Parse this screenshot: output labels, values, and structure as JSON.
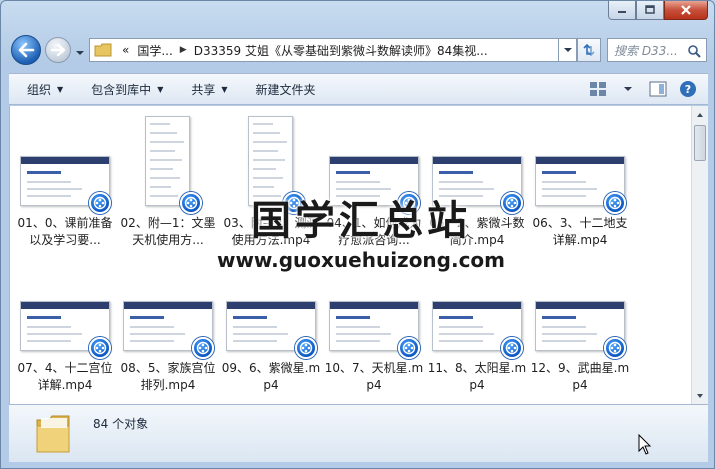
{
  "window": {
    "caption_buttons": [
      "minimize",
      "maximize",
      "close"
    ]
  },
  "address_bar": {
    "overflow": "«",
    "crumbs": [
      "国学...",
      "D33359 艾姐《从零基础到紫微斗数解读师》84集视..."
    ],
    "search_placeholder": "搜索 D33..."
  },
  "toolbar": {
    "items": [
      {
        "label": "组织",
        "has_arrow": true
      },
      {
        "label": "包含到库中",
        "has_arrow": true
      },
      {
        "label": "共享",
        "has_arrow": true
      },
      {
        "label": "新建文件夹",
        "has_arrow": false
      }
    ]
  },
  "files": [
    {
      "label": "01、0、课前准备以及学习要...",
      "thumb": "wide"
    },
    {
      "label": "02、附—1：文墨天机使用方...",
      "thumb": "tall"
    },
    {
      "label": "03、附—2：测测使用方法.mp4",
      "thumb": "tall"
    },
    {
      "label": "04、1、如何成为疗愈派咨询...",
      "thumb": "wide"
    },
    {
      "label": "05、2、紫微斗数简介.mp4",
      "thumb": "wide"
    },
    {
      "label": "06、3、十二地支详解.mp4",
      "thumb": "wide"
    },
    {
      "label": "07、4、十二宫位详解.mp4",
      "thumb": "wide"
    },
    {
      "label": "08、5、家族宫位排列.mp4",
      "thumb": "wide"
    },
    {
      "label": "09、6、紫微星.mp4",
      "thumb": "wide"
    },
    {
      "label": "10、7、天机星.mp4",
      "thumb": "wide"
    },
    {
      "label": "11、8、太阳星.mp4",
      "thumb": "wide"
    },
    {
      "label": "12、9、武曲星.mp4",
      "thumb": "wide"
    }
  ],
  "watermark": {
    "title": "国学汇总站",
    "url": "www.guoxuehuizong.com"
  },
  "details": {
    "count": "84 个对象"
  },
  "colors": {
    "badge": "#0d58c2",
    "frame": "#b3cbe6",
    "close": "#c7503a"
  }
}
